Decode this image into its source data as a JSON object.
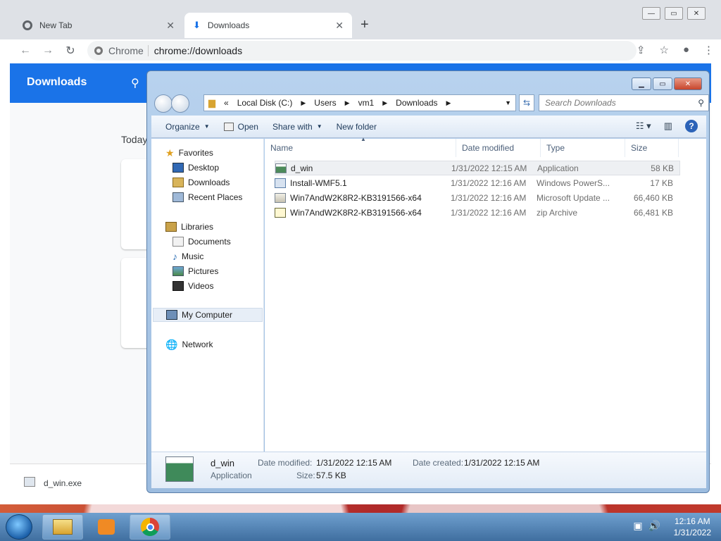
{
  "chrome": {
    "tabs": [
      {
        "label": "New Tab",
        "icon": "chrome-icon"
      },
      {
        "label": "Downloads",
        "icon": "download-icon"
      }
    ],
    "window_controls": [
      "minimize",
      "maximize",
      "close"
    ],
    "address": {
      "site": "Chrome",
      "url": "chrome://downloads"
    },
    "page": {
      "header_title": "Downloads",
      "section": "Today"
    },
    "shelf_file": "d_win.exe"
  },
  "explorer": {
    "breadcrumb": {
      "prefix": "«",
      "parts": [
        "Local Disk (C:)",
        "Users",
        "vm1",
        "Downloads"
      ]
    },
    "search_placeholder": "Search Downloads",
    "commands": {
      "organize": "Organize",
      "open": "Open",
      "share_with": "Share with",
      "new_folder": "New folder"
    },
    "nav": {
      "favorites": "Favorites",
      "desktop": "Desktop",
      "downloads": "Downloads",
      "recent_places": "Recent Places",
      "libraries": "Libraries",
      "documents": "Documents",
      "music": "Music",
      "pictures": "Pictures",
      "videos": "Videos",
      "my_computer": "My Computer",
      "network": "Network"
    },
    "columns": {
      "name": "Name",
      "date": "Date modified",
      "type": "Type",
      "size": "Size"
    },
    "files": [
      {
        "name": "d_win",
        "date": "1/31/2022 12:15 AM",
        "type": "Application",
        "size": "58 KB",
        "icon": "exe"
      },
      {
        "name": "Install-WMF5.1",
        "date": "1/31/2022 12:16 AM",
        "type": "Windows PowerS...",
        "size": "17 KB",
        "icon": "ps"
      },
      {
        "name": "Win7AndW2K8R2-KB3191566-x64",
        "date": "1/31/2022 12:16 AM",
        "type": "Microsoft Update ...",
        "size": "66,460 KB",
        "icon": "msu"
      },
      {
        "name": "Win7AndW2K8R2-KB3191566-x64",
        "date": "1/31/2022 12:16 AM",
        "type": "zip Archive",
        "size": "66,481 KB",
        "icon": "zip"
      }
    ],
    "details": {
      "name": "d_win",
      "kind": "Application",
      "modified_label": "Date modified:",
      "modified_value": "1/31/2022 12:15 AM",
      "created_label": "Date created:",
      "created_value": "1/31/2022 12:15 AM",
      "size_label": "Size:",
      "size_value": "57.5 KB"
    }
  },
  "taskbar": {
    "time": "12:16 AM",
    "date": "1/31/2022"
  }
}
